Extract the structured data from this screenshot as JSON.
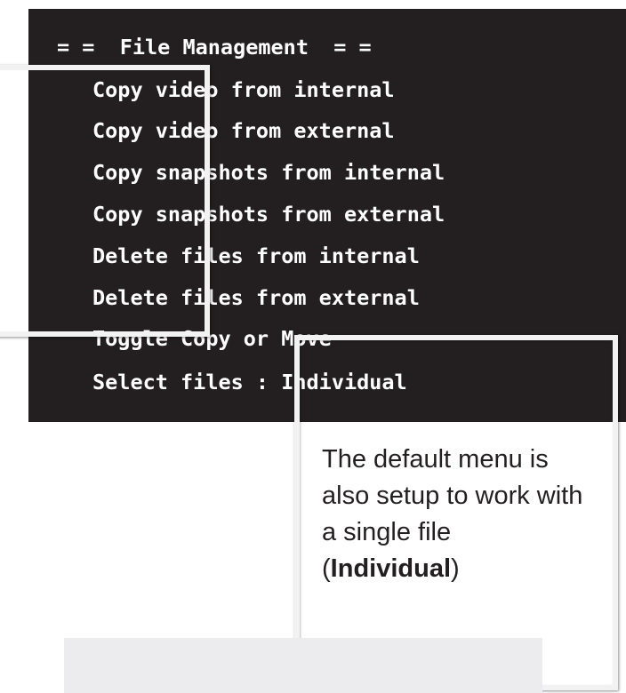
{
  "terminal": {
    "title": "= =  File Management  = =",
    "items": [
      {
        "label": "Copy video from internal"
      },
      {
        "label": "Copy video from external"
      },
      {
        "label": "Copy snapshots from internal"
      },
      {
        "label": "Copy snapshots from external"
      },
      {
        "label": "Delete files from internal"
      },
      {
        "label": "Delete files from external"
      },
      {
        "label": "Toggle Copy or Move"
      },
      {
        "label": "Select files : Individual"
      }
    ]
  },
  "callout": {
    "text_before": "The default menu is also setup to work with a single file (",
    "bold": "Individual",
    "text_after": ")"
  },
  "colors": {
    "terminal_bg": "#231f20",
    "terminal_text": "#ffffff",
    "highlight_frame": "#f2f2f2",
    "callout_text": "#231f20",
    "footer_bar": "#ececee"
  }
}
